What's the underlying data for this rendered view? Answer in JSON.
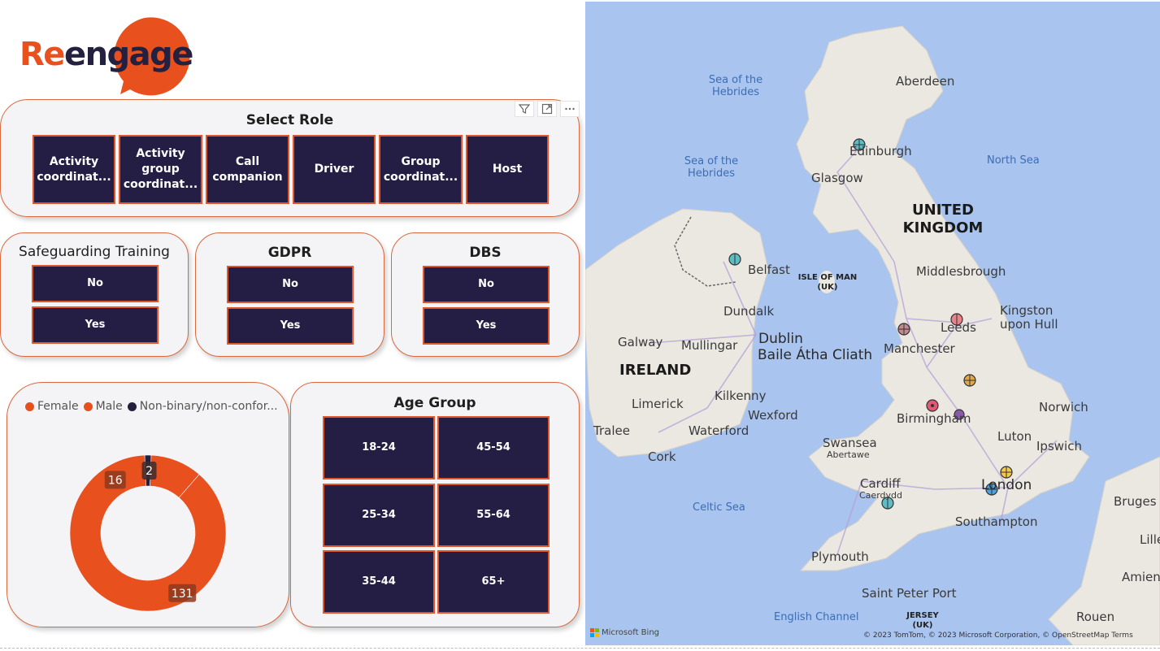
{
  "logo": {
    "text_re": "Re",
    "text_engage": "engage",
    "brand_color": "#e8501e",
    "dark_color": "#24203f"
  },
  "role_slicer": {
    "title": "Select Role",
    "options": [
      "Activity coordinat...",
      "Activity group coordinat...",
      "Call companion",
      "Driver",
      "Group coordinat...",
      "Host"
    ]
  },
  "visual_header_icons": [
    "filter-icon",
    "focus-mode-icon",
    "more-options-icon"
  ],
  "safeguarding": {
    "title": "Safeguarding Training",
    "options": [
      "No",
      "Yes"
    ]
  },
  "gdpr": {
    "title": "GDPR",
    "options": [
      "No",
      "Yes"
    ]
  },
  "dbs": {
    "title": "DBS",
    "options": [
      "No",
      "Yes"
    ]
  },
  "gender_legend": [
    {
      "label": "Female",
      "color": "#e8501e"
    },
    {
      "label": "Male",
      "color": "#e8501e"
    },
    {
      "label": "Non-binary/non-confor...",
      "color": "#24203f"
    }
  ],
  "chart_data": {
    "type": "pie",
    "subtype": "donut",
    "title": "",
    "series": [
      {
        "name": "Female",
        "value": 131,
        "color": "#e8501e"
      },
      {
        "name": "Male",
        "value": 16,
        "color": "#e8501e"
      },
      {
        "name": "Non-binary/non-confor...",
        "value": 2,
        "color": "#24203f"
      }
    ],
    "data_labels": [
      "131",
      "16",
      "2"
    ],
    "legend_position": "top-left"
  },
  "age_group": {
    "title": "Age Group",
    "options": [
      "18-24",
      "45-54",
      "25-34",
      "55-64",
      "35-44",
      "65+"
    ]
  },
  "map": {
    "seas": [
      "Sea of the Hebrides",
      "Sea of the Hebrides",
      "North Sea",
      "Celtic Sea",
      "English Channel"
    ],
    "countries": [
      "UNITED KINGDOM",
      "IRELAND"
    ],
    "regions": [
      "ISLE OF MAN (UK)",
      "JERSEY (UK)"
    ],
    "cities": [
      "Aberdeen",
      "Edinburgh",
      "Glasgow",
      "Belfast",
      "Middlesbrough",
      "Dundalk",
      "Dublin",
      "Baile Átha Cliath",
      "Galway",
      "Mullingar",
      "Leeds",
      "Kingston upon Hull",
      "Manchester",
      "Limerick",
      "Kilkenny",
      "Wexford",
      "Waterford",
      "Tralee",
      "Cork",
      "Birmingham",
      "Norwich",
      "Luton",
      "Ipswich",
      "Swansea",
      "Abertawe",
      "Cardiff",
      "Caerdydd",
      "London",
      "Southampton",
      "Plymouth",
      "Saint Peter Port",
      "Bruges",
      "Lille",
      "Amiens",
      "Rouen"
    ],
    "provider": "Microsoft Bing",
    "attribution": "© 2023 TomTom, © 2023 Microsoft Corporation, © OpenStreetMap  Terms"
  }
}
